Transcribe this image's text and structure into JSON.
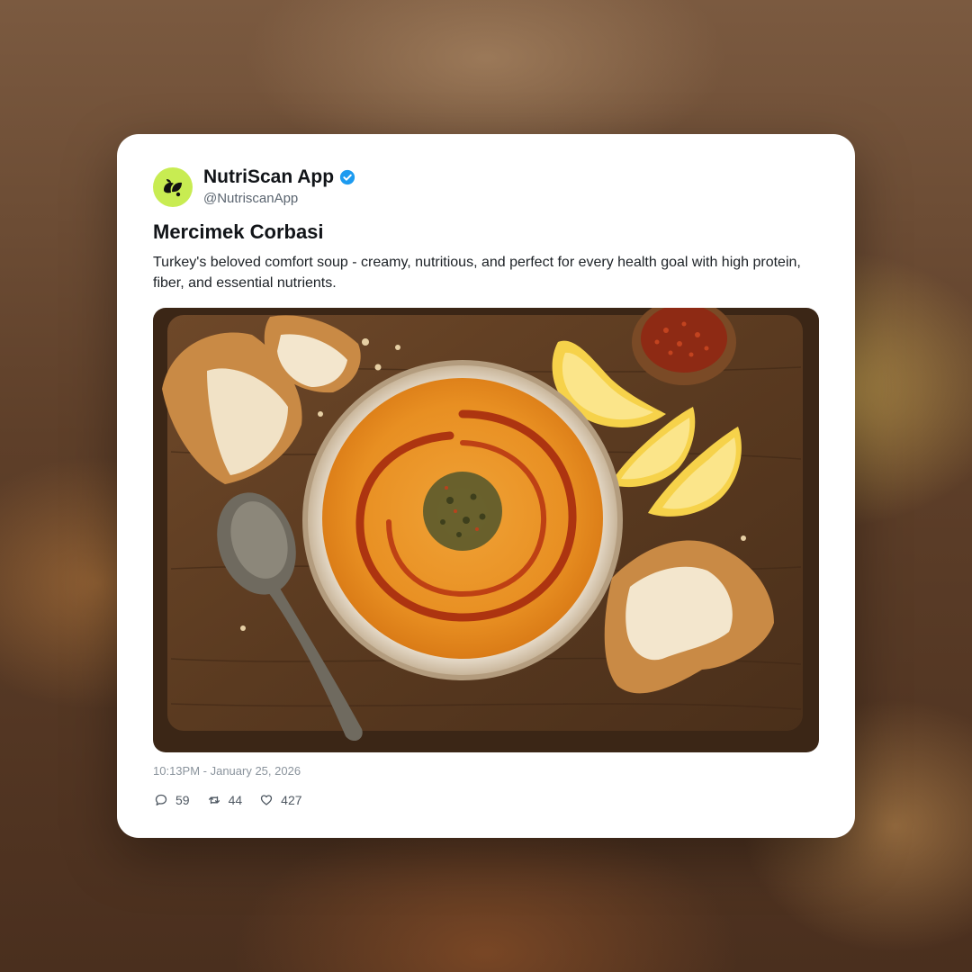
{
  "post": {
    "author": {
      "display_name": "NutriScan App",
      "handle": "@NutriscanApp",
      "verified": true,
      "avatar_color": "#c8ec52"
    },
    "title": "Mercimek Corbasi",
    "description": "Turkey's beloved comfort soup - creamy, nutritious, and perfect for every health goal with high protein, fiber, and essential nutrients.",
    "image_subject": "lentil soup in a bowl on a wooden board with bread, lemon wedges, chili flakes and a spoon",
    "timestamp": "10:13PM - January 25, 2026",
    "stats": {
      "replies": "59",
      "reposts": "44",
      "likes": "427"
    }
  },
  "icons": {
    "avatar": "leaf-logo-icon",
    "verified": "verified-badge-icon",
    "reply": "comment-bubble-icon",
    "repost": "repost-arrows-icon",
    "like": "heart-icon"
  },
  "colors": {
    "verified_badge": "#1d9bf0",
    "text_primary": "#111418",
    "text_secondary": "#5b6570",
    "timestamp": "#8a939c"
  }
}
